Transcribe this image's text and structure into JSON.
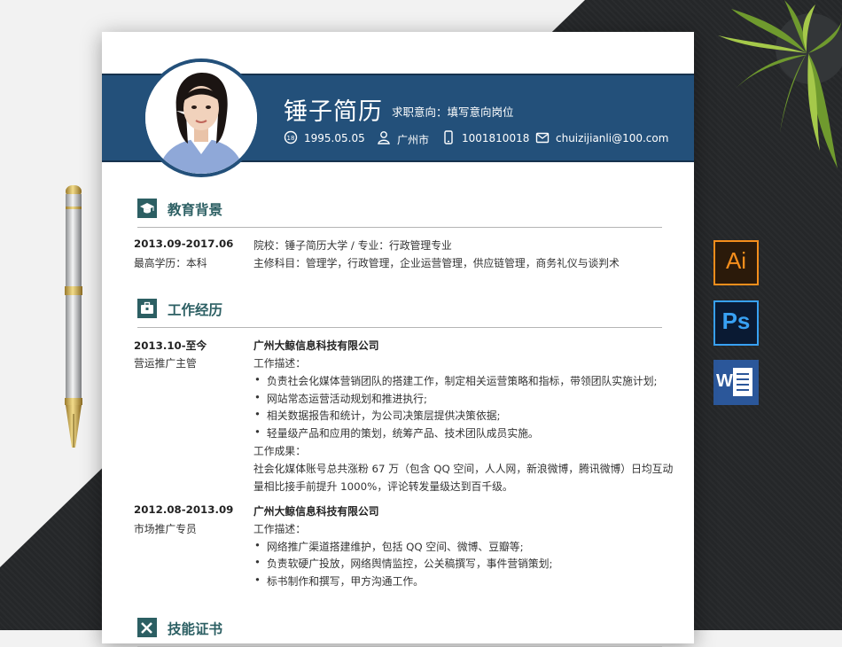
{
  "header": {
    "name": "锤子简历",
    "intent": "求职意向：填写意向岗位",
    "birth": "1995.05.05",
    "city": "广州市",
    "phone": "1001810018",
    "email": "chuizijianli@100.com"
  },
  "education": {
    "title": "教育背景",
    "period": "2013.09-2017.06",
    "degree": "最高学历：本科",
    "school_line": "院校：锤子简历大学    /    专业：行政管理专业",
    "courses": "主修科目：管理学，行政管理，企业运营管理，供应链管理，商务礼仪与谈判术"
  },
  "work": {
    "title": "工作经历",
    "jobs": [
      {
        "period": "2013.10-至今",
        "position": "营运推广主管",
        "company": "广州大鲸信息科技有限公司",
        "desc_label": "工作描述：",
        "bullets": [
          "负责社会化媒体营销团队的搭建工作，制定相关运营策略和指标，带领团队实施计划;",
          "网站常态运营活动规划和推进执行;",
          "相关数据报告和统计，为公司决策层提供决策依据;",
          "轻量级产品和应用的策划，统筹产品、技术团队成员实施。"
        ],
        "result_label": "工作成果：",
        "result_lines": [
          "社会化媒体账号总共涨粉 67 万（包含 QQ 空间，人人网，新浪微博，腾讯微博）日均互动",
          "量相比接手前提升 1000%，评论转发量级达到百千级。"
        ]
      },
      {
        "period": "2012.08-2013.09",
        "position": "市场推广专员",
        "company": "广州大鲸信息科技有限公司",
        "desc_label": "工作描述：",
        "bullets": [
          "网络推广渠道搭建维护，包括 QQ 空间、微博、豆瓣等;",
          "负责软硬广投放，网络舆情监控，公关稿撰写，事件营销策划;",
          "标书制作和撰写，甲方沟通工作。"
        ]
      }
    ]
  },
  "skills": {
    "title": "技能证书"
  },
  "software_icons": {
    "ai": "Ai",
    "ps": "Ps",
    "word": "W"
  },
  "colors": {
    "accent": "#23507a",
    "section": "#2c5f63",
    "dark_bg": "#26282a"
  }
}
